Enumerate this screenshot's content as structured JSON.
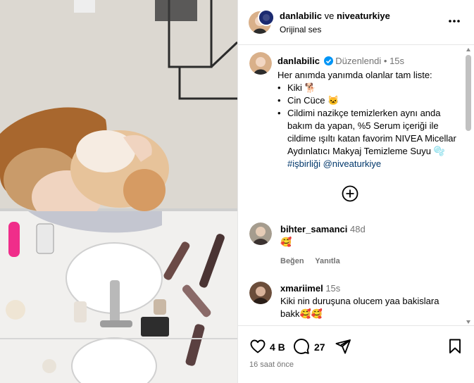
{
  "header": {
    "author": "danlabilic",
    "joiner": "ve",
    "collaborator": "niveaturkiye",
    "audio": "Orijinal ses",
    "more_icon": "more-horizontal-icon"
  },
  "caption": {
    "username": "danlabilic",
    "edited": "Düzenlendi",
    "separator": "•",
    "time": "15s",
    "intro": "Her anımda yanımda olanlar tam liste:",
    "bullets": [
      "Kiki 🐕",
      "Cin Cüce 🐱",
      "Cildimi nazikçe temizlerken aynı anda bakım da yapan, %5 Serum içeriği ile cildime ışıltı katan favorim NIVEA Micellar Aydınlatıcı Makyaj Temizleme Suyu 🫧"
    ],
    "hashtag": "#işbirliği",
    "mention": "@niveaturkiye"
  },
  "comments": [
    {
      "username": "bihter_samanci",
      "time": "48d",
      "text": "🥰",
      "like": "Beğen",
      "reply": "Yanıtla"
    },
    {
      "username": "xmariimel",
      "time": "15s",
      "text": "Kiki nin duruşuna olucem yaa bakislara bakk🥰🥰"
    }
  ],
  "actions": {
    "like_count": "4 B",
    "comment_count": "27",
    "timestamp": "16 saat önce"
  },
  "colors": {
    "verified": "#0095f6",
    "border": "#e6e6e6",
    "muted": "#737373"
  }
}
